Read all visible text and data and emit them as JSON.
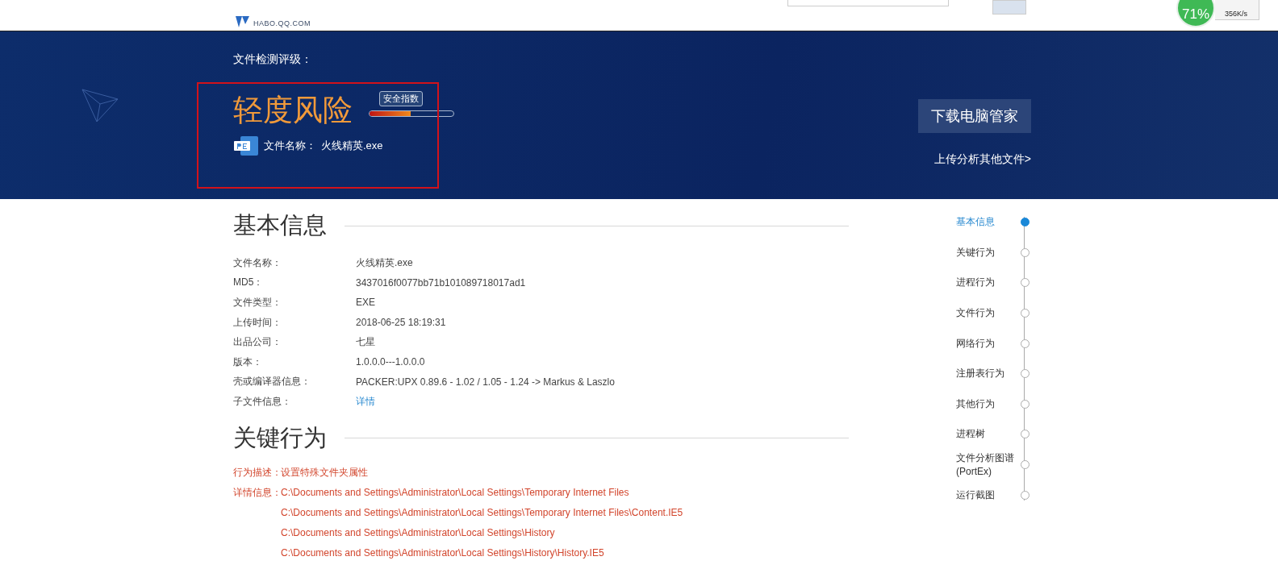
{
  "header": {
    "domain": "HABO.QQ.COM"
  },
  "widget": {
    "percent": "71%",
    "speed": "356K/s"
  },
  "banner": {
    "rating_label": "文件检测评级：",
    "risk": "轻度风险",
    "meter_label": "安全指数",
    "level": 0.49,
    "file_label": "文件名称：",
    "file_name": "火线精英.exe",
    "download_button": "下载电脑管家",
    "upload_link": "上传分析其他文件>"
  },
  "basic_info": {
    "title": "基本信息",
    "rows": [
      {
        "label": "文件名称：",
        "value": "火线精英.exe",
        "kind": "text"
      },
      {
        "label": "MD5：",
        "value": "3437016f0077bb71b101089718017ad1",
        "kind": "text"
      },
      {
        "label": "文件类型：",
        "value": "EXE",
        "kind": "text"
      },
      {
        "label": "上传时间：",
        "value": "2018-06-25 18:19:31",
        "kind": "text"
      },
      {
        "label": "出品公司：",
        "value": "七星",
        "kind": "text"
      },
      {
        "label": "版本：",
        "value": "1.0.0.0---1.0.0.0",
        "kind": "text"
      },
      {
        "label": "壳或编译器信息：",
        "value": "PACKER:UPX 0.89.6 - 1.02 / 1.05 - 1.24 -> Markus & Laszlo",
        "kind": "text"
      },
      {
        "label": "子文件信息：",
        "value": "详情",
        "kind": "link"
      }
    ]
  },
  "key_behavior": {
    "title": "关键行为",
    "description_label": "行为描述：",
    "description": "设置特殊文件夹属性",
    "details_label": "详情信息：",
    "details": [
      "C:\\Documents and Settings\\Administrator\\Local Settings\\Temporary Internet Files",
      "C:\\Documents and Settings\\Administrator\\Local Settings\\Temporary Internet Files\\Content.IE5",
      "C:\\Documents and Settings\\Administrator\\Local Settings\\History",
      "C:\\Documents and Settings\\Administrator\\Local Settings\\History\\History.IE5"
    ]
  },
  "side_nav": [
    {
      "label": "基本信息",
      "selected": true
    },
    {
      "label": "关键行为",
      "selected": false
    },
    {
      "label": "进程行为",
      "selected": false
    },
    {
      "label": "文件行为",
      "selected": false
    },
    {
      "label": "网络行为",
      "selected": false
    },
    {
      "label": "注册表行为",
      "selected": false
    },
    {
      "label": "其他行为",
      "selected": false
    },
    {
      "label": "进程树",
      "selected": false
    },
    {
      "label": "文件分析图谱(PortEx)",
      "selected": false
    },
    {
      "label": "运行截图",
      "selected": false
    }
  ]
}
